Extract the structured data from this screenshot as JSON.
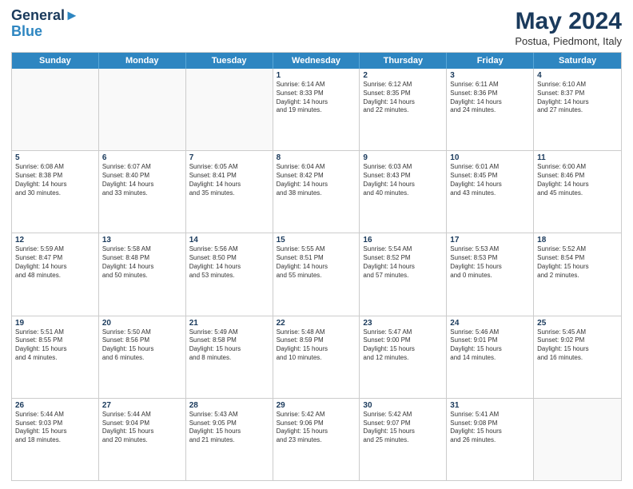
{
  "header": {
    "logo_line1": "General",
    "logo_line2": "Blue",
    "month": "May 2024",
    "location": "Postua, Piedmont, Italy"
  },
  "days_of_week": [
    "Sunday",
    "Monday",
    "Tuesday",
    "Wednesday",
    "Thursday",
    "Friday",
    "Saturday"
  ],
  "weeks": [
    [
      {
        "day": "",
        "text": ""
      },
      {
        "day": "",
        "text": ""
      },
      {
        "day": "",
        "text": ""
      },
      {
        "day": "1",
        "text": "Sunrise: 6:14 AM\nSunset: 8:33 PM\nDaylight: 14 hours\nand 19 minutes."
      },
      {
        "day": "2",
        "text": "Sunrise: 6:12 AM\nSunset: 8:35 PM\nDaylight: 14 hours\nand 22 minutes."
      },
      {
        "day": "3",
        "text": "Sunrise: 6:11 AM\nSunset: 8:36 PM\nDaylight: 14 hours\nand 24 minutes."
      },
      {
        "day": "4",
        "text": "Sunrise: 6:10 AM\nSunset: 8:37 PM\nDaylight: 14 hours\nand 27 minutes."
      }
    ],
    [
      {
        "day": "5",
        "text": "Sunrise: 6:08 AM\nSunset: 8:38 PM\nDaylight: 14 hours\nand 30 minutes."
      },
      {
        "day": "6",
        "text": "Sunrise: 6:07 AM\nSunset: 8:40 PM\nDaylight: 14 hours\nand 33 minutes."
      },
      {
        "day": "7",
        "text": "Sunrise: 6:05 AM\nSunset: 8:41 PM\nDaylight: 14 hours\nand 35 minutes."
      },
      {
        "day": "8",
        "text": "Sunrise: 6:04 AM\nSunset: 8:42 PM\nDaylight: 14 hours\nand 38 minutes."
      },
      {
        "day": "9",
        "text": "Sunrise: 6:03 AM\nSunset: 8:43 PM\nDaylight: 14 hours\nand 40 minutes."
      },
      {
        "day": "10",
        "text": "Sunrise: 6:01 AM\nSunset: 8:45 PM\nDaylight: 14 hours\nand 43 minutes."
      },
      {
        "day": "11",
        "text": "Sunrise: 6:00 AM\nSunset: 8:46 PM\nDaylight: 14 hours\nand 45 minutes."
      }
    ],
    [
      {
        "day": "12",
        "text": "Sunrise: 5:59 AM\nSunset: 8:47 PM\nDaylight: 14 hours\nand 48 minutes."
      },
      {
        "day": "13",
        "text": "Sunrise: 5:58 AM\nSunset: 8:48 PM\nDaylight: 14 hours\nand 50 minutes."
      },
      {
        "day": "14",
        "text": "Sunrise: 5:56 AM\nSunset: 8:50 PM\nDaylight: 14 hours\nand 53 minutes."
      },
      {
        "day": "15",
        "text": "Sunrise: 5:55 AM\nSunset: 8:51 PM\nDaylight: 14 hours\nand 55 minutes."
      },
      {
        "day": "16",
        "text": "Sunrise: 5:54 AM\nSunset: 8:52 PM\nDaylight: 14 hours\nand 57 minutes."
      },
      {
        "day": "17",
        "text": "Sunrise: 5:53 AM\nSunset: 8:53 PM\nDaylight: 15 hours\nand 0 minutes."
      },
      {
        "day": "18",
        "text": "Sunrise: 5:52 AM\nSunset: 8:54 PM\nDaylight: 15 hours\nand 2 minutes."
      }
    ],
    [
      {
        "day": "19",
        "text": "Sunrise: 5:51 AM\nSunset: 8:55 PM\nDaylight: 15 hours\nand 4 minutes."
      },
      {
        "day": "20",
        "text": "Sunrise: 5:50 AM\nSunset: 8:56 PM\nDaylight: 15 hours\nand 6 minutes."
      },
      {
        "day": "21",
        "text": "Sunrise: 5:49 AM\nSunset: 8:58 PM\nDaylight: 15 hours\nand 8 minutes."
      },
      {
        "day": "22",
        "text": "Sunrise: 5:48 AM\nSunset: 8:59 PM\nDaylight: 15 hours\nand 10 minutes."
      },
      {
        "day": "23",
        "text": "Sunrise: 5:47 AM\nSunset: 9:00 PM\nDaylight: 15 hours\nand 12 minutes."
      },
      {
        "day": "24",
        "text": "Sunrise: 5:46 AM\nSunset: 9:01 PM\nDaylight: 15 hours\nand 14 minutes."
      },
      {
        "day": "25",
        "text": "Sunrise: 5:45 AM\nSunset: 9:02 PM\nDaylight: 15 hours\nand 16 minutes."
      }
    ],
    [
      {
        "day": "26",
        "text": "Sunrise: 5:44 AM\nSunset: 9:03 PM\nDaylight: 15 hours\nand 18 minutes."
      },
      {
        "day": "27",
        "text": "Sunrise: 5:44 AM\nSunset: 9:04 PM\nDaylight: 15 hours\nand 20 minutes."
      },
      {
        "day": "28",
        "text": "Sunrise: 5:43 AM\nSunset: 9:05 PM\nDaylight: 15 hours\nand 21 minutes."
      },
      {
        "day": "29",
        "text": "Sunrise: 5:42 AM\nSunset: 9:06 PM\nDaylight: 15 hours\nand 23 minutes."
      },
      {
        "day": "30",
        "text": "Sunrise: 5:42 AM\nSunset: 9:07 PM\nDaylight: 15 hours\nand 25 minutes."
      },
      {
        "day": "31",
        "text": "Sunrise: 5:41 AM\nSunset: 9:08 PM\nDaylight: 15 hours\nand 26 minutes."
      },
      {
        "day": "",
        "text": ""
      }
    ]
  ]
}
